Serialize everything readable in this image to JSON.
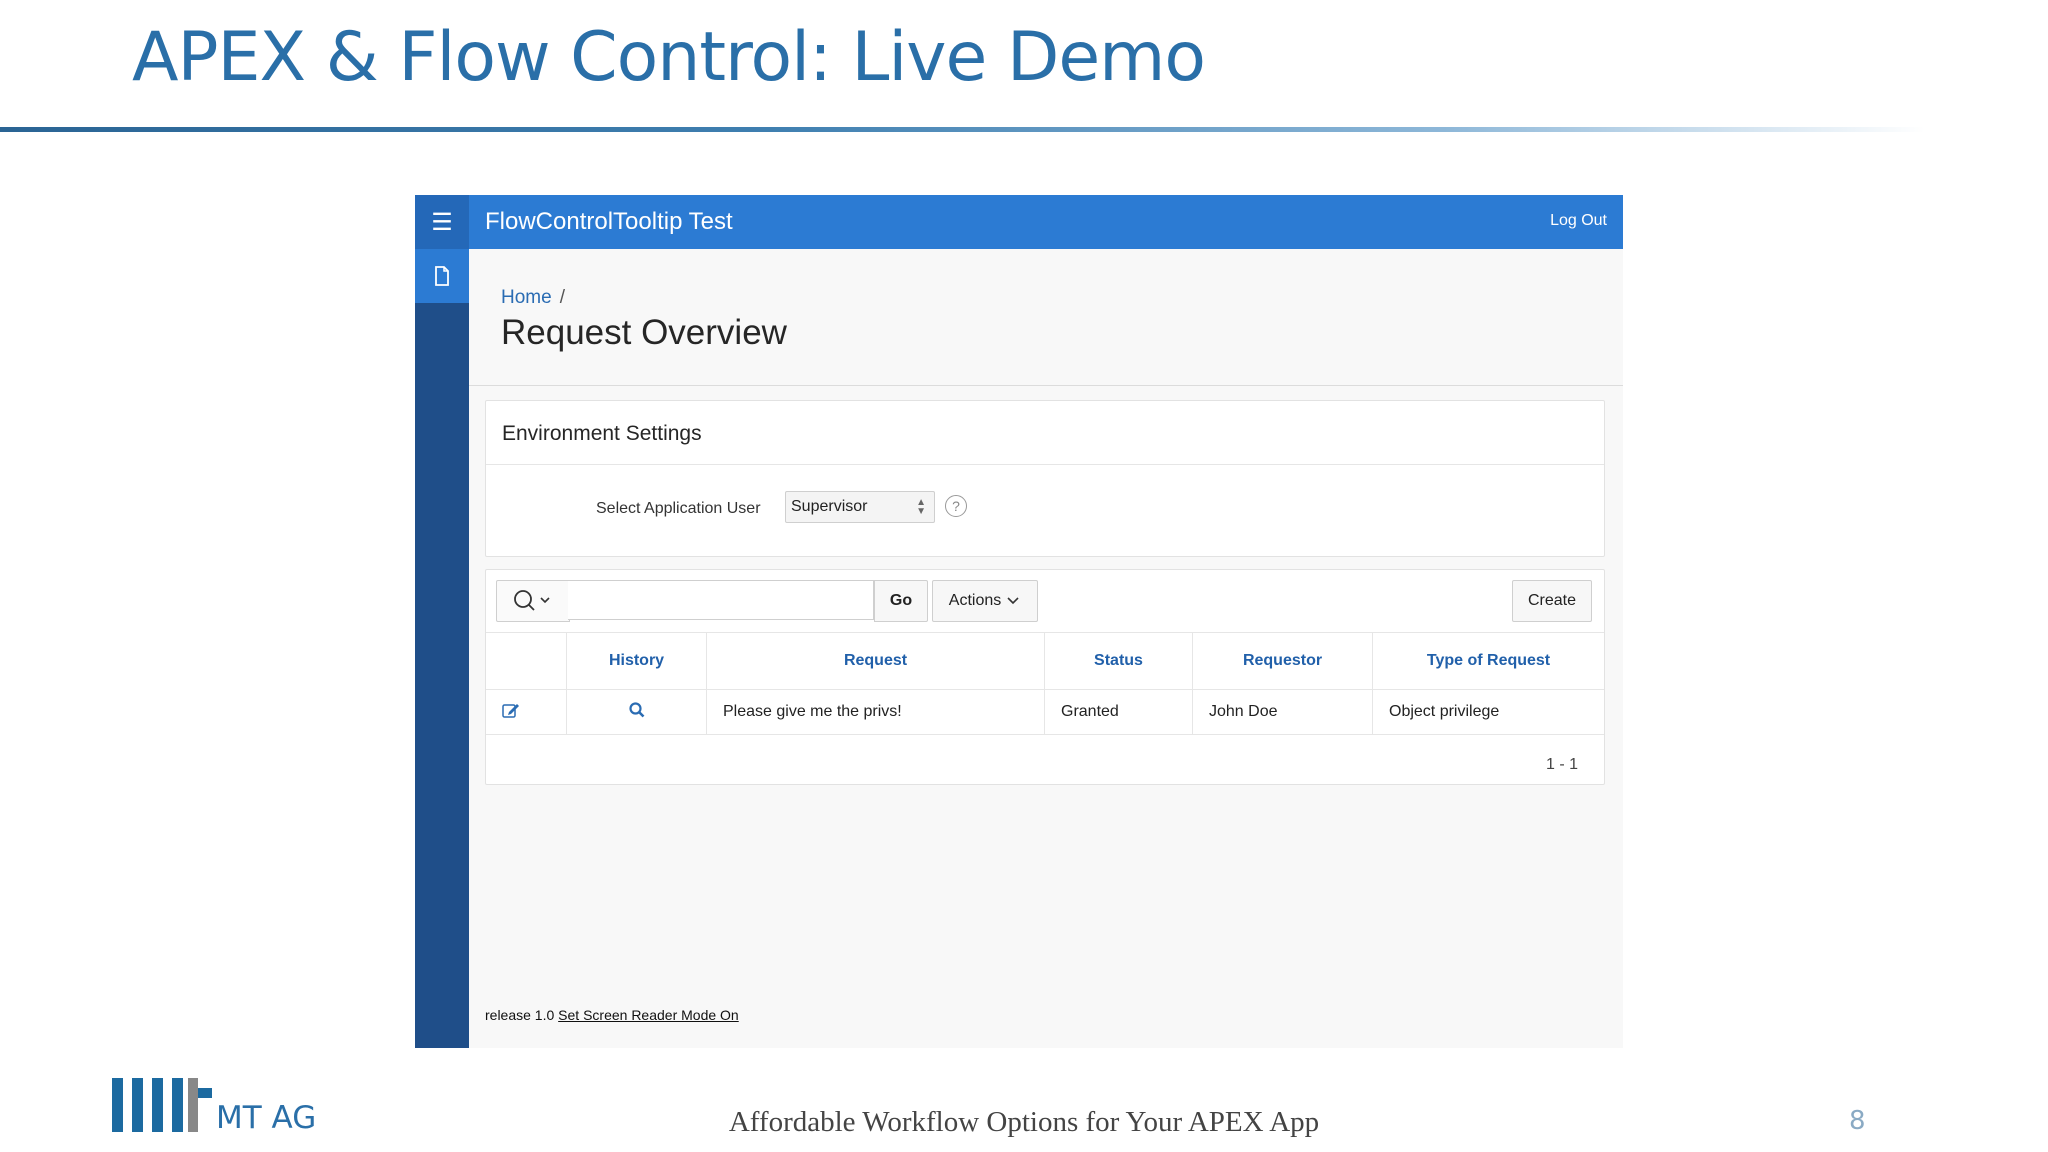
{
  "slide": {
    "title": "APEX & Flow Control: Live Demo",
    "footer": "Affordable Workflow Options for Your APEX App",
    "page_number": "8",
    "logo_text": "MT AG",
    "accent_color": "#2a6fa8"
  },
  "app": {
    "title": "FlowControlTooltip Test",
    "logout_label": "Log Out",
    "menu_icon": "hamburger-icon",
    "nav_icon": "page-icon",
    "header_color": "#2c7bd3",
    "nav_color": "#1f4e89"
  },
  "breadcrumb": {
    "home": "Home",
    "separator": "/"
  },
  "page_title": "Request Overview",
  "environment": {
    "title": "Environment Settings",
    "user_label": "Select Application User",
    "user_value": "Supervisor",
    "help_icon": "help-icon"
  },
  "toolbar": {
    "go_label": "Go",
    "actions_label": "Actions",
    "create_label": "Create",
    "search_placeholder": ""
  },
  "report": {
    "columns": [
      "",
      "History",
      "Request",
      "Status",
      "Requestor",
      "Type of Request"
    ],
    "rows": [
      {
        "edit_icon": "edit-icon",
        "history_icon": "search-icon",
        "request": "Please give me the privs!",
        "status": "Granted",
        "requestor": "John Doe",
        "type": "Object privilege"
      }
    ],
    "pagination": "1 - 1"
  },
  "footer": {
    "release": "release 1.0",
    "screen_reader_link": "Set Screen Reader Mode On"
  }
}
